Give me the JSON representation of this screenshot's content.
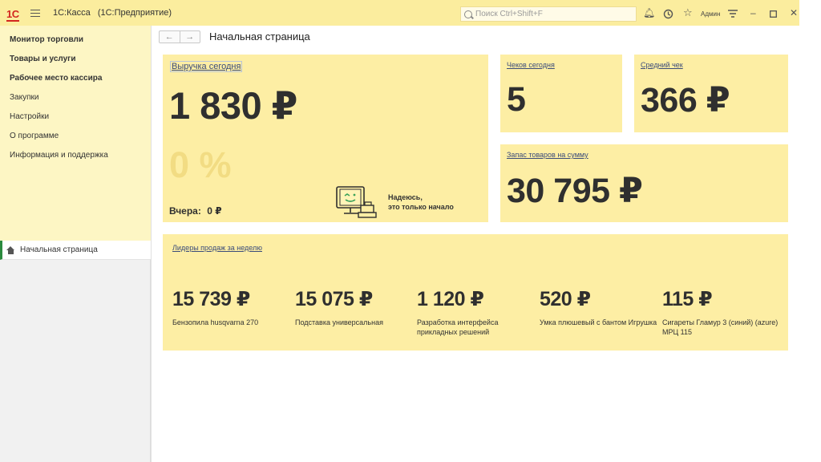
{
  "titlebar": {
    "logo": "1С",
    "app_name": "1С:Касса",
    "platform": "(1С:Предприятие)",
    "search_placeholder": "Поиск Ctrl+Shift+F",
    "user": "Админ",
    "icons": [
      "bell-icon",
      "history-icon",
      "star-icon",
      "settings-icon",
      "minimize-icon",
      "maximize-icon",
      "close-icon"
    ]
  },
  "sidebar": {
    "items": [
      {
        "label": "Монитор торговли",
        "bold": true
      },
      {
        "label": "Товары и услуги",
        "bold": true
      },
      {
        "label": "Рабочее место кассира",
        "bold": true
      },
      {
        "label": "Закупки",
        "bold": false
      },
      {
        "label": "Настройки",
        "bold": false
      },
      {
        "label": "О программе",
        "bold": false
      },
      {
        "label": "Информация и поддержка",
        "bold": false
      }
    ],
    "open_tab": "Начальная страница"
  },
  "page": {
    "title": "Начальная страница"
  },
  "revenue": {
    "link": "Выручка сегодня",
    "value": "1 830 ₽",
    "percent": "0 %",
    "yesterday_label": "Вчера:",
    "yesterday_value": "0 ₽",
    "hope_line1": "Надеюсь,",
    "hope_line2": "это только начало"
  },
  "receipts": {
    "link": "Чеков сегодня",
    "value": "5"
  },
  "avg_receipt": {
    "link": "Средний чек",
    "value": "366 ₽"
  },
  "stock": {
    "link": "Запас товаров на сумму",
    "value": "30 795 ₽"
  },
  "leaders": {
    "link": "Лидеры продаж за неделю",
    "items": [
      {
        "value": "15 739 ₽",
        "name": "Бензопила husqvarna 270"
      },
      {
        "value": "15 075 ₽",
        "name": "Подставка универсальная"
      },
      {
        "value": "1 120 ₽",
        "name": "Разработка интерфейса прикладных решений"
      },
      {
        "value": "520 ₽",
        "name": "Умка плюшевый с бантом Игрушка"
      },
      {
        "value": "115 ₽",
        "name": "Сигареты Гламур 3 (синий) (azure) МРЦ 115"
      }
    ]
  },
  "colors": {
    "titlebar": "#fbed9e",
    "sidebar": "#fdf6c4",
    "card": "#fdeea4",
    "active_tab_marker": "#2b8a3e"
  }
}
